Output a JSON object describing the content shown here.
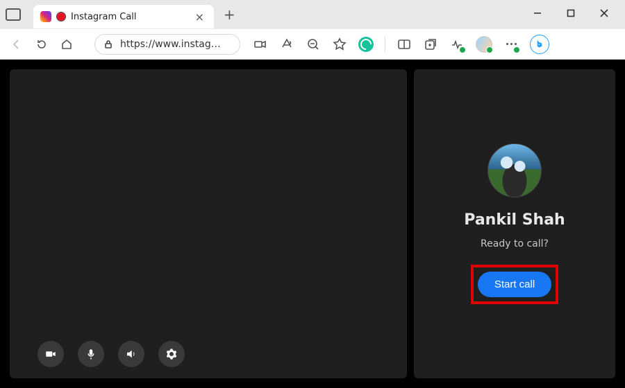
{
  "browser": {
    "tab": {
      "title": "Instagram Call"
    },
    "address": "https://www.instag…"
  },
  "call": {
    "contact_name": "Pankil Shah",
    "prompt": "Ready to call?",
    "button_label": "Start call"
  },
  "icons": {
    "instagram": "instagram",
    "record": "record",
    "back": "back",
    "refresh": "refresh",
    "home": "home",
    "lock": "lock",
    "device": "device-camera",
    "read_aloud": "read-aloud",
    "zoom_out": "zoom-out",
    "favorite": "star",
    "grammarly": "grammarly",
    "sidebar": "sidebar",
    "collections": "collections",
    "performance": "performance",
    "profile": "profile",
    "more": "more",
    "bing": "bing-chat",
    "video": "video",
    "mic": "mic",
    "volume": "volume",
    "settings": "settings"
  }
}
